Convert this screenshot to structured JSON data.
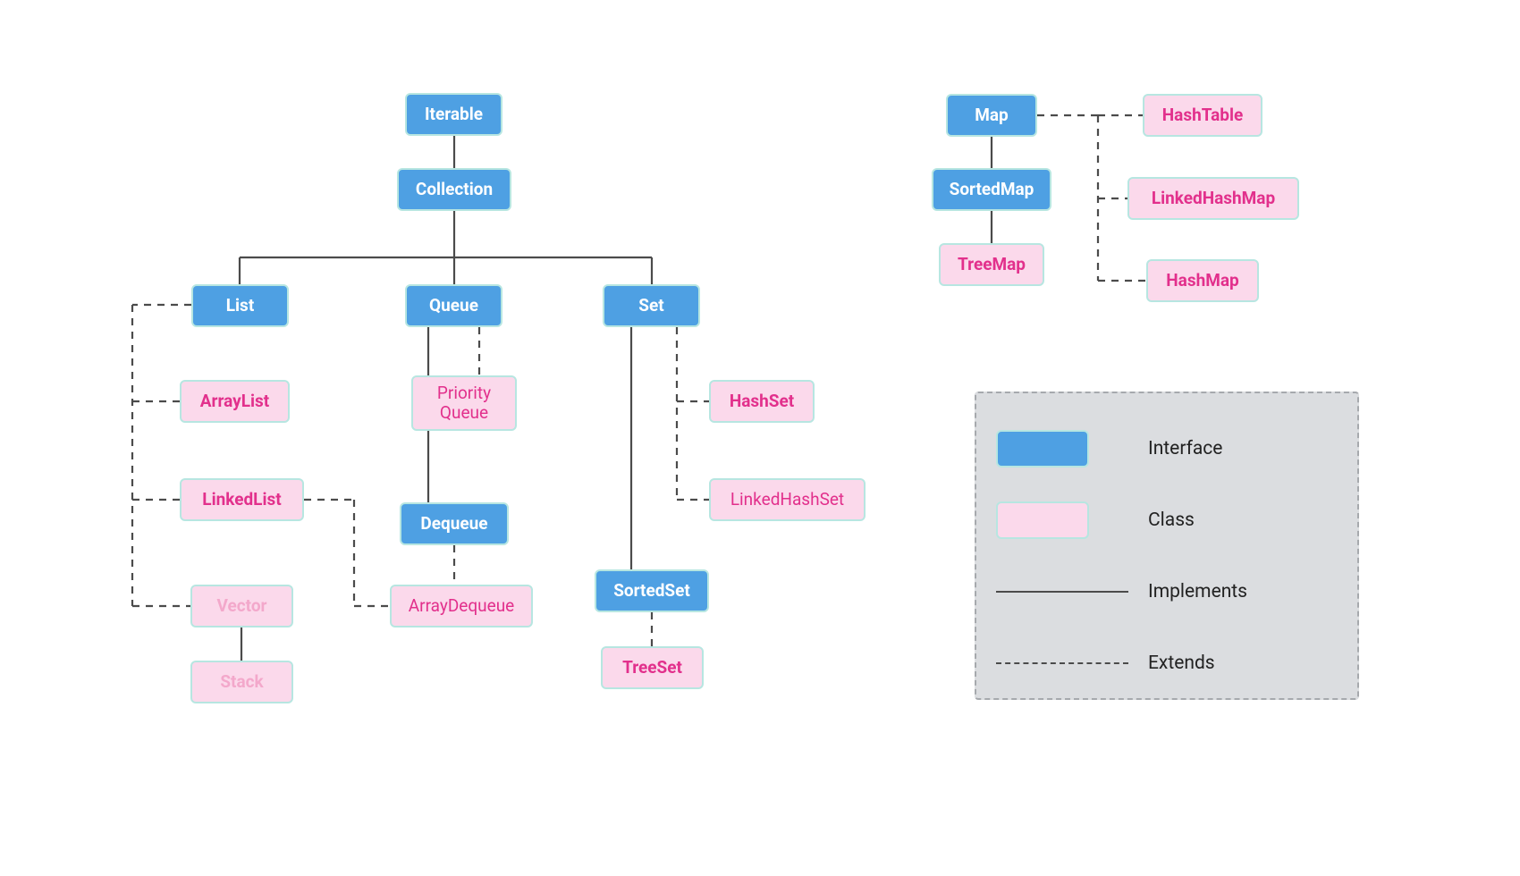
{
  "nodes": {
    "iterable": {
      "label": "Iterable",
      "type": "interface"
    },
    "collection": {
      "label": "Collection",
      "type": "interface"
    },
    "list": {
      "label": "List",
      "type": "interface"
    },
    "queue": {
      "label": "Queue",
      "type": "interface"
    },
    "set": {
      "label": "Set",
      "type": "interface"
    },
    "dequeue": {
      "label": "Dequeue",
      "type": "interface"
    },
    "sortedset": {
      "label": "SortedSet",
      "type": "interface"
    },
    "arraylist": {
      "label": "ArrayList",
      "type": "class"
    },
    "linkedlist": {
      "label": "LinkedList",
      "type": "class"
    },
    "vector": {
      "label": "Vector",
      "type": "class"
    },
    "stack": {
      "label": "Stack",
      "type": "class"
    },
    "priorityqueue": {
      "label": "Priority Queue",
      "type": "class"
    },
    "arraydequeue": {
      "label": "ArrayDequeue",
      "type": "class"
    },
    "hashset": {
      "label": "HashSet",
      "type": "class"
    },
    "linkedhashset": {
      "label": "LinkedHashSet",
      "type": "class"
    },
    "treeset": {
      "label": "TreeSet",
      "type": "class"
    },
    "map": {
      "label": "Map",
      "type": "interface"
    },
    "sortedmap": {
      "label": "SortedMap",
      "type": "interface"
    },
    "treemap": {
      "label": "TreeMap",
      "type": "class"
    },
    "hashtable": {
      "label": "HashTable",
      "type": "class"
    },
    "linkedhashmap": {
      "label": "LinkedHashMap",
      "type": "class"
    },
    "hashmap": {
      "label": "HashMap",
      "type": "class"
    }
  },
  "edges": [
    {
      "from": "iterable",
      "to": "collection",
      "kind": "implements"
    },
    {
      "from": "collection",
      "to": "list",
      "kind": "implements"
    },
    {
      "from": "collection",
      "to": "queue",
      "kind": "implements"
    },
    {
      "from": "collection",
      "to": "set",
      "kind": "implements"
    },
    {
      "from": "list",
      "to": "arraylist",
      "kind": "extends"
    },
    {
      "from": "list",
      "to": "linkedlist",
      "kind": "extends"
    },
    {
      "from": "list",
      "to": "vector",
      "kind": "extends"
    },
    {
      "from": "vector",
      "to": "stack",
      "kind": "implements"
    },
    {
      "from": "queue",
      "to": "priorityqueue",
      "kind": "extends"
    },
    {
      "from": "queue",
      "to": "dequeue",
      "kind": "implements"
    },
    {
      "from": "dequeue",
      "to": "arraydequeue",
      "kind": "extends"
    },
    {
      "from": "linkedlist",
      "to": "arraydequeue",
      "kind": "extends",
      "note": "routed"
    },
    {
      "from": "set",
      "to": "hashset",
      "kind": "extends"
    },
    {
      "from": "set",
      "to": "linkedhashset",
      "kind": "extends"
    },
    {
      "from": "set",
      "to": "sortedset",
      "kind": "implements"
    },
    {
      "from": "sortedset",
      "to": "treeset",
      "kind": "extends"
    },
    {
      "from": "map",
      "to": "sortedmap",
      "kind": "implements"
    },
    {
      "from": "sortedmap",
      "to": "treemap",
      "kind": "implements"
    },
    {
      "from": "map",
      "to": "hashtable",
      "kind": "extends"
    },
    {
      "from": "map",
      "to": "linkedhashmap",
      "kind": "extends"
    },
    {
      "from": "map",
      "to": "hashmap",
      "kind": "extends"
    }
  ],
  "legend": {
    "interface": "Interface",
    "class": "Class",
    "implements": "Implements",
    "extends": "Extends"
  },
  "colors": {
    "interface_bg": "#4ea0e3",
    "class_bg": "#fbd9eb",
    "class_text": "#e2308c",
    "border": "#b7e6e1",
    "line": "#4b4b4b"
  }
}
